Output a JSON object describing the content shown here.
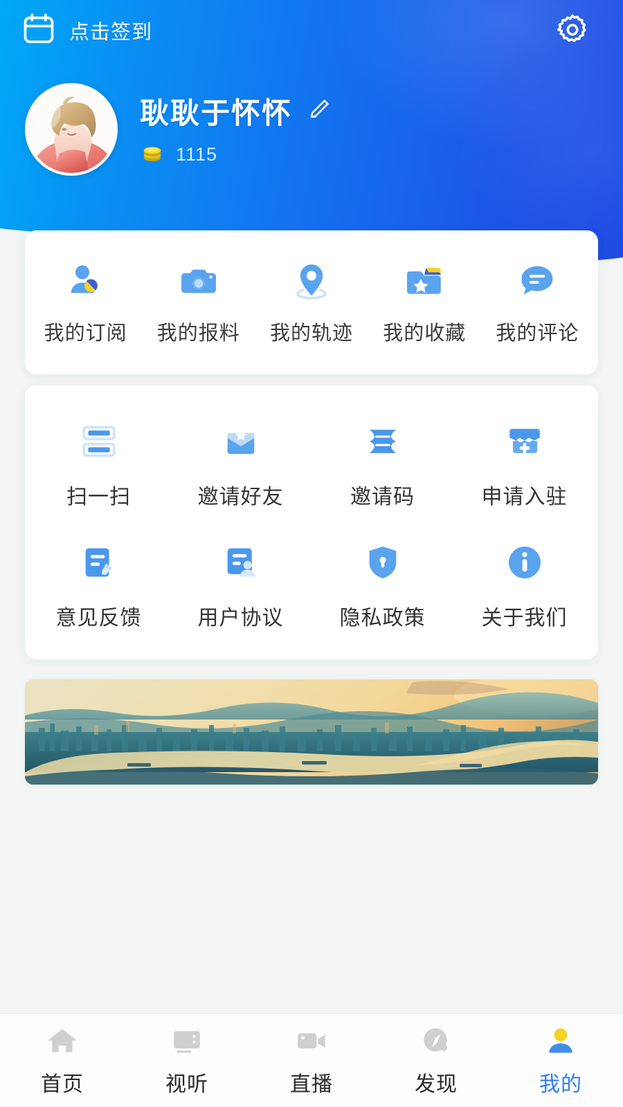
{
  "theme": {
    "gradient_start": "#00a8f7",
    "gradient_end": "#1f4ae3",
    "accent_blue": "#2f7df0",
    "icon_blue": "#5aa3ef",
    "icon_yellow": "#f5d223",
    "page_bg": "#f2f5f4",
    "card_bg": "#ffffff"
  },
  "topbar": {
    "signin_label": "点击签到",
    "calendar_icon": "calendar-icon",
    "settings_icon": "gear-icon"
  },
  "profile": {
    "avatar_icon": "avatar",
    "username": "耿耿于怀怀",
    "edit_icon": "pencil-edit-icon",
    "coin_icon": "coin-stack-icon",
    "coin_count": "1115"
  },
  "quick_access": {
    "items": [
      {
        "label": "我的订阅",
        "icon": "person-subscribe-icon"
      },
      {
        "label": "我的报料",
        "icon": "camera-icon"
      },
      {
        "label": "我的轨迹",
        "icon": "location-pin-icon"
      },
      {
        "label": "我的收藏",
        "icon": "folder-star-icon"
      },
      {
        "label": "我的评论",
        "icon": "comment-bubble-icon"
      }
    ]
  },
  "tools": {
    "items": [
      {
        "label": "扫一扫",
        "icon": "scan-icon"
      },
      {
        "label": "邀请好友",
        "icon": "envelope-invite-icon"
      },
      {
        "label": "邀请码",
        "icon": "ticket-icon"
      },
      {
        "label": "申请入驻",
        "icon": "shop-apply-icon"
      },
      {
        "label": "意见反馈",
        "icon": "feedback-doc-icon"
      },
      {
        "label": "用户协议",
        "icon": "agreement-doc-icon"
      },
      {
        "label": "隐私政策",
        "icon": "shield-lock-icon"
      },
      {
        "label": "关于我们",
        "icon": "info-circle-icon"
      }
    ]
  },
  "banner": {
    "icon": "city-river-sunset-banner"
  },
  "tabbar": {
    "items": [
      {
        "label": "首页",
        "icon": "home-icon",
        "active": false
      },
      {
        "label": "视听",
        "icon": "tv-icon",
        "active": false
      },
      {
        "label": "直播",
        "icon": "video-camera-icon",
        "active": false
      },
      {
        "label": "发现",
        "icon": "compass-icon",
        "active": false
      },
      {
        "label": "我的",
        "icon": "user-icon",
        "active": true
      }
    ]
  }
}
